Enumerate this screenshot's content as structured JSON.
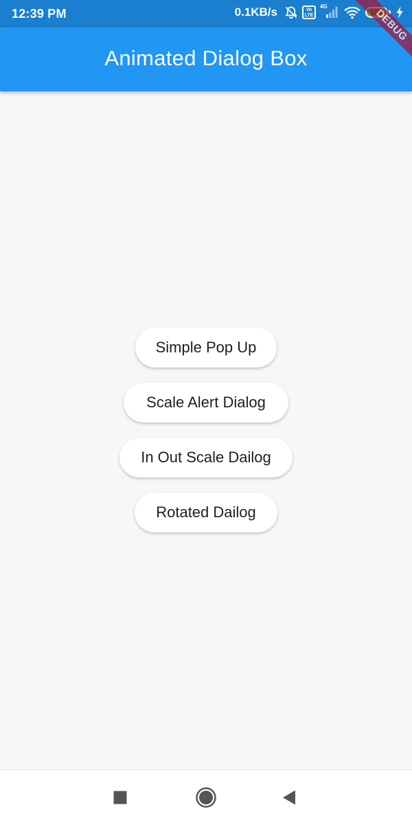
{
  "status_bar": {
    "time": "12:39 PM",
    "network_speed": "0.1KB/s",
    "volte_label": "Vo LTE",
    "network_type": "4G",
    "battery_level": "100",
    "icons": [
      "alarm-off-icon",
      "volte-icon",
      "signal-icon",
      "wifi-icon",
      "battery-icon",
      "charging-icon"
    ]
  },
  "app_bar": {
    "title": "Animated Dialog Box",
    "color": "#2196f3"
  },
  "debug_banner": {
    "label": "DEBUG"
  },
  "buttons": [
    {
      "label": "Simple Pop Up"
    },
    {
      "label": "Scale Alert Dialog"
    },
    {
      "label": "In Out Scale Dailog"
    },
    {
      "label": "Rotated Dailog"
    }
  ],
  "nav_bar": {
    "icons": [
      "recents-icon",
      "home-icon",
      "back-icon"
    ]
  }
}
